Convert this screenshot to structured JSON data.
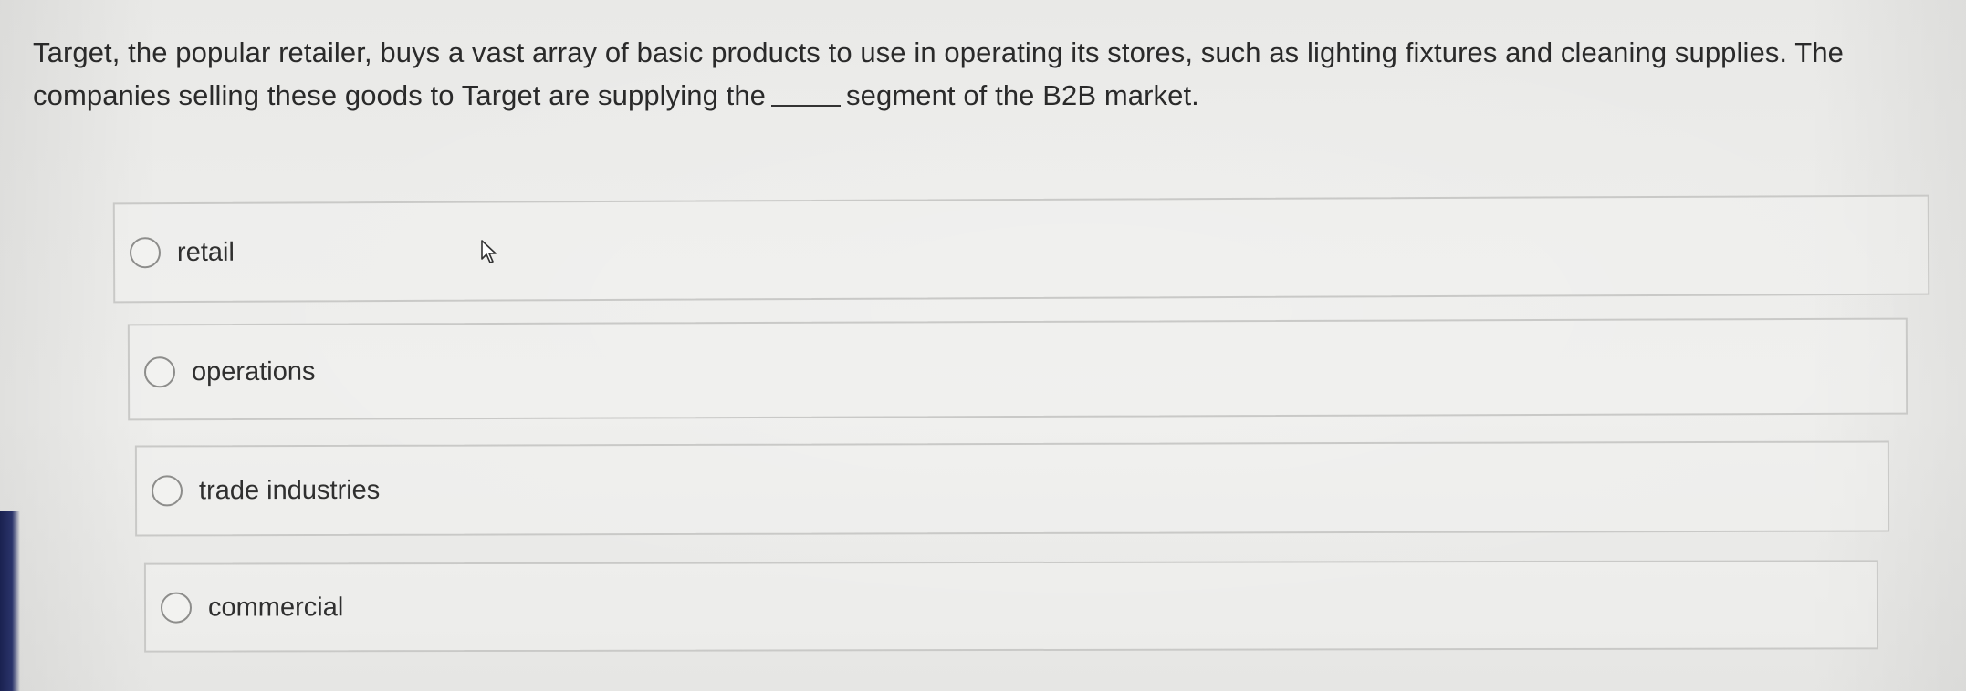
{
  "question": {
    "text_before": "Target, the popular retailer, buys a vast array of basic products to use in operating its stores, such as lighting fixtures and cleaning supplies. The companies selling these goods to Target are supplying the",
    "text_after": "segment of the B2B market."
  },
  "options": [
    {
      "label": "retail"
    },
    {
      "label": "operations"
    },
    {
      "label": "trade industries"
    },
    {
      "label": "commercial"
    }
  ],
  "icons": {
    "cursor": "mouse-pointer-icon",
    "radio": "radio-unselected-icon"
  }
}
